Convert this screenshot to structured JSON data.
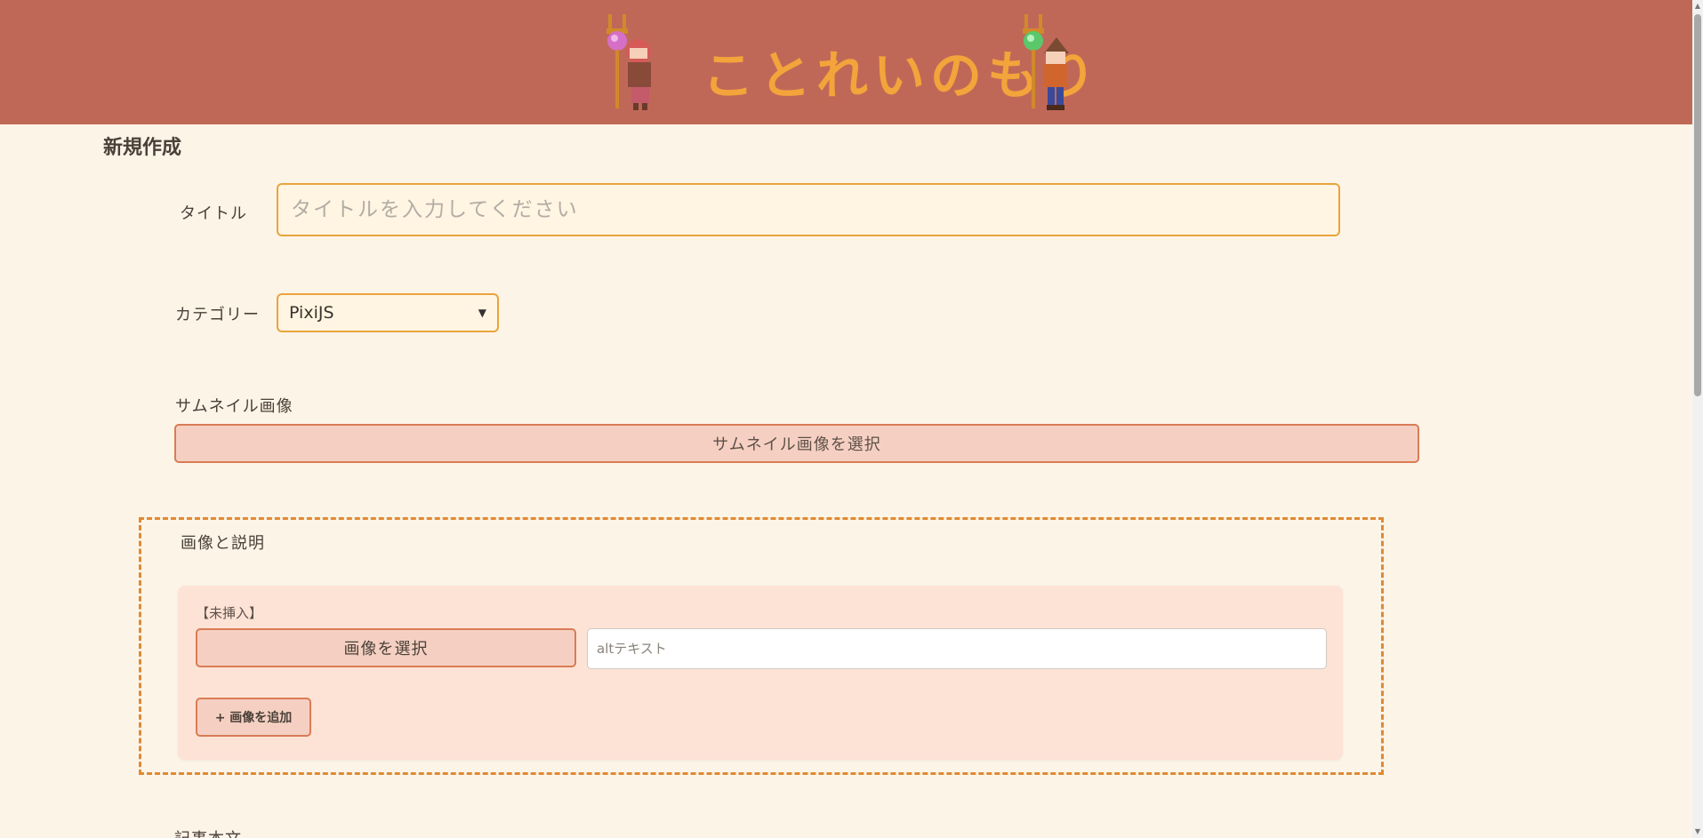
{
  "header": {
    "logo_text": "ことれいのもり"
  },
  "page": {
    "title": "新規作成"
  },
  "form": {
    "title_label": "タイトル",
    "title_placeholder": "タイトルを入力してください",
    "category_label": "カテゴリー",
    "category_selected": "PixiJS",
    "thumbnail_label": "サムネイル画像",
    "thumbnail_button": "サムネイル画像を選択",
    "images_section_label": "画像と説明",
    "image_items": [
      {
        "status": "【未挿入】",
        "select_button": "画像を選択",
        "alt_placeholder": "altテキスト"
      }
    ],
    "add_image_button": "+ 画像を追加",
    "body_label": "記事本文"
  },
  "colors": {
    "header_bg": "#c06858",
    "logo": "#f3a43a",
    "page_bg": "#fdf4e8",
    "accent_border": "#eaa43c",
    "button_bg": "#f5d0c2",
    "button_border": "#d97c55",
    "dashed_border": "#e08a33"
  },
  "icons": {
    "select": "chevron-down-icon",
    "left_character": "mage-girl-icon",
    "right_character": "mage-boy-icon"
  }
}
